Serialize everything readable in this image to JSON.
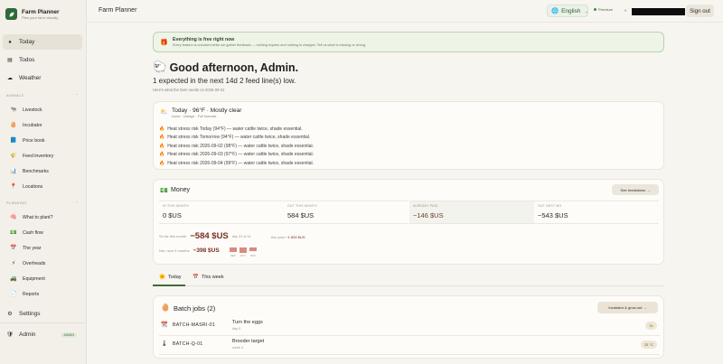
{
  "sidebar": {
    "brand_title": "Farm Planner",
    "brand_sub": "Plan your farm visually",
    "main_items": [
      {
        "label": "Today",
        "icon": "sun-icon"
      },
      {
        "label": "Todos",
        "icon": "checklist-icon"
      },
      {
        "label": "Weather",
        "icon": "cloud-icon"
      }
    ],
    "animals_label": "ANIMALS",
    "animals_items": [
      {
        "label": "Livestock"
      },
      {
        "label": "Incubator"
      },
      {
        "label": "Price book"
      },
      {
        "label": "Feed inventory"
      },
      {
        "label": "Benchmarks"
      },
      {
        "label": "Locations"
      }
    ],
    "planning_label": "PLANNING",
    "planning_items": [
      {
        "label": "What to plant?"
      },
      {
        "label": "Cash flow"
      },
      {
        "label": "The year"
      },
      {
        "label": "Overheads"
      },
      {
        "label": "Equipment"
      },
      {
        "label": "Reports"
      }
    ],
    "settings_label": "Settings",
    "admin_label": "Admin",
    "admin_badge": "ADMIN"
  },
  "topbar": {
    "title": "Farm Planner",
    "language": "English",
    "premium": "Premium",
    "signout": "Sign out"
  },
  "banner": {
    "title": "Everything is free right now",
    "text": "Every feature is unlocked while we gather feedback — nothing expires and nothing is charged. Tell us what is missing or wrong."
  },
  "greeting": "Good afternoon, Admin.",
  "summary": "1 expected in the next 14d   2 feed line(s) low.",
  "datebar": "Here's what the farm needs on 2026-09-31",
  "weather": {
    "title": "Today · 96°F · Mostly clear",
    "location": "home · change · Full forecast",
    "alerts": [
      "Heat stress risk Today (94°F) — water cattle twice, shade essential.",
      "Heat stress risk Tomorrow (94°F) — water cattle twice, shade essential.",
      "Heat stress risk 2026-09-02 (98°F) — water cattle twice, shade essential.",
      "Heat stress risk 2026-09-03 (97°F) — water cattle twice, shade essential.",
      "Heat stress risk 2026-09-04 (99°F) — water cattle twice, shade essential."
    ]
  },
  "money": {
    "title": "Money",
    "breakdown_btn": "See breakdown →",
    "stats": [
      {
        "label": "IN THIS MONTH",
        "value": "0 $US"
      },
      {
        "label": "OUT THIS MONTH",
        "value": "584 $US"
      },
      {
        "label": "ALREADY PAID",
        "value": "−146 $US"
      },
      {
        "label": "OUT NEXT MO.",
        "value": "−543 $US"
      }
    ],
    "sofar_label": "So far this month",
    "sofar_value": "−584 $US",
    "sofar_note": "day 31 of 31",
    "thisyear_label": "this year",
    "thisyear_value": "−1 826 $US",
    "net_label": "Net, next 3 months",
    "net_value": "−398 $US",
    "bar_labels": [
      "SEP",
      "OCT",
      "NOV"
    ],
    "bar_values": [
      -130,
      -160,
      -110
    ]
  },
  "tabs": [
    {
      "label": "Today"
    },
    {
      "label": "This week"
    }
  ],
  "batch": {
    "title": "Batch jobs (2)",
    "button": "Incubator & grow-out →",
    "jobs": [
      {
        "code": "BATCH-MASRI-01",
        "task": "Turn the eggs",
        "sub": "day 0",
        "pill": "3×"
      },
      {
        "code": "BATCH-Q-01",
        "task": "Brooder target",
        "sub": "week 4",
        "pill": "25 °C"
      }
    ]
  },
  "colors": {
    "brand": "#2f6b3a",
    "negative": "#7a2e22",
    "banner_bg": "#eef4e8",
    "page_bg": "#f7f5f0"
  }
}
